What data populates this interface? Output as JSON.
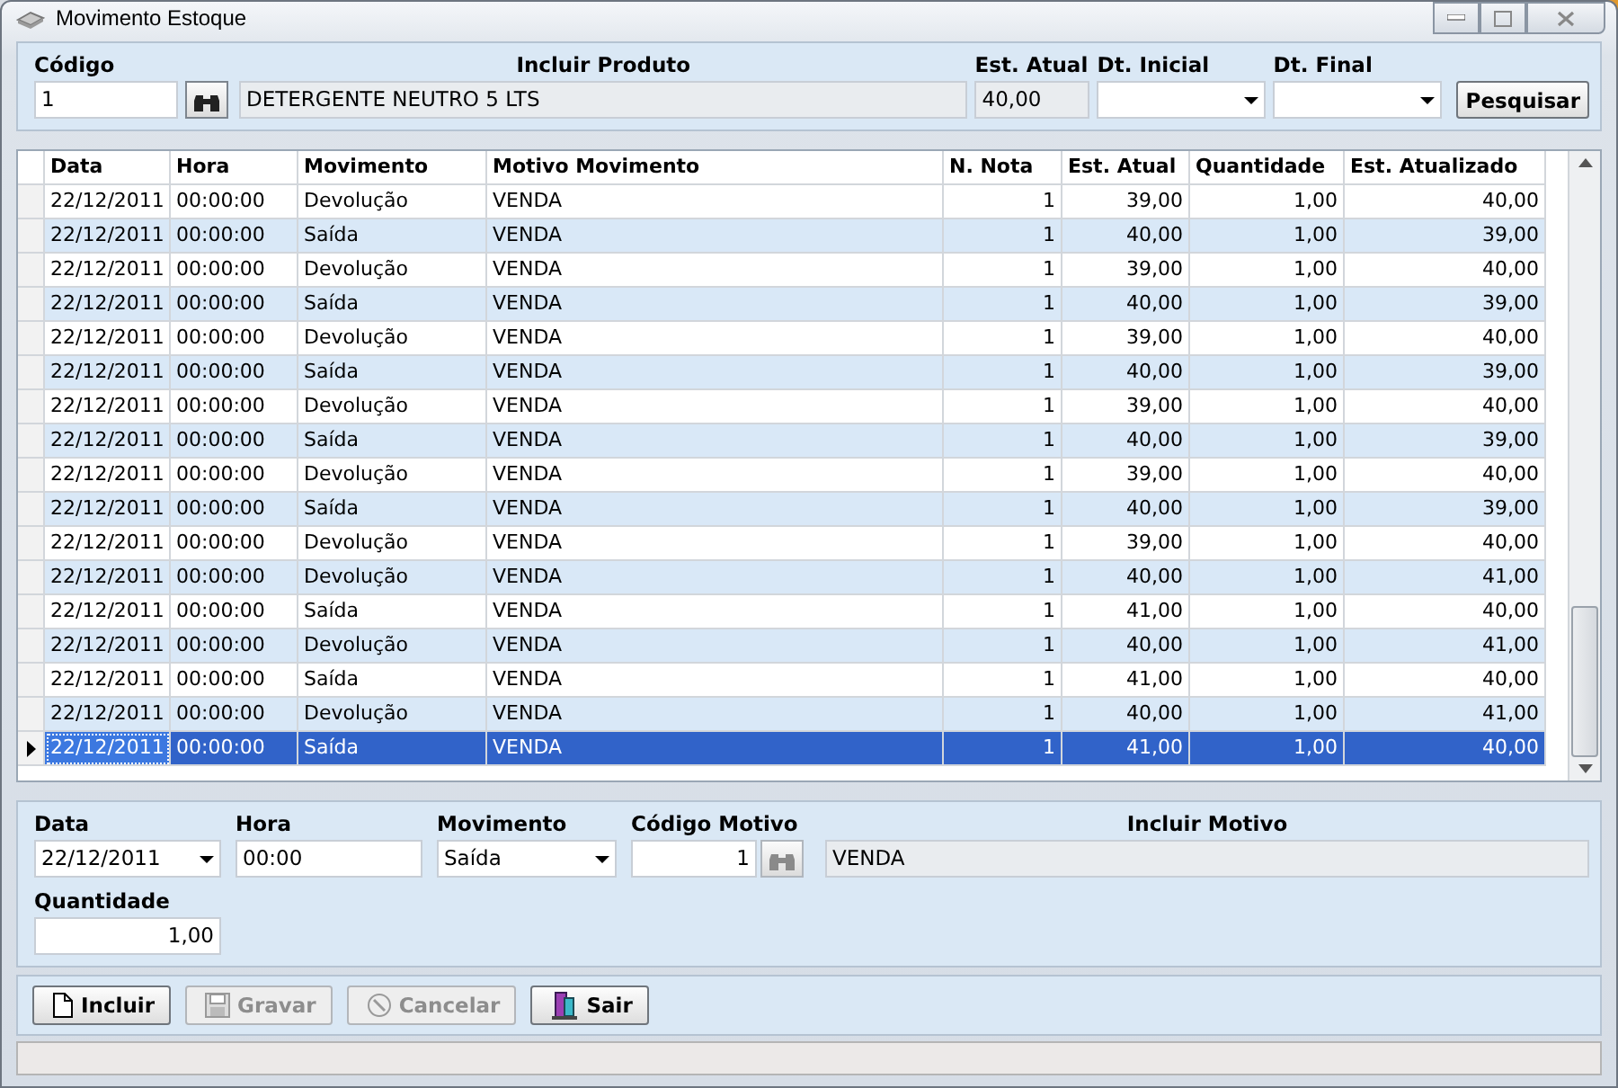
{
  "window": {
    "title": "Movimento Estoque"
  },
  "filter": {
    "codigo_label": "Código",
    "codigo": "1",
    "produto_label": "Incluir Produto",
    "produto": "DETERGENTE NEUTRO 5 LTS",
    "est_atual_label": "Est. Atual",
    "est_atual": "40,00",
    "dt_inicial_label": "Dt. Inicial",
    "dt_final_label": "Dt. Final",
    "search_button": "Pesquisar"
  },
  "table": {
    "columns": [
      "Data",
      "Hora",
      "Movimento",
      "Motivo Movimento",
      "N. Nota",
      "Est. Atual",
      "Quantidade",
      "Est. Atualizado"
    ],
    "rows": [
      {
        "cells": [
          "22/12/2011",
          "00:00:00",
          "Devolução",
          "VENDA",
          "1",
          "39,00",
          "1,00",
          "40,00"
        ],
        "selected": false
      },
      {
        "cells": [
          "22/12/2011",
          "00:00:00",
          "Saída",
          "VENDA",
          "1",
          "40,00",
          "1,00",
          "39,00"
        ],
        "selected": false
      },
      {
        "cells": [
          "22/12/2011",
          "00:00:00",
          "Devolução",
          "VENDA",
          "1",
          "39,00",
          "1,00",
          "40,00"
        ],
        "selected": false
      },
      {
        "cells": [
          "22/12/2011",
          "00:00:00",
          "Saída",
          "VENDA",
          "1",
          "40,00",
          "1,00",
          "39,00"
        ],
        "selected": false
      },
      {
        "cells": [
          "22/12/2011",
          "00:00:00",
          "Devolução",
          "VENDA",
          "1",
          "39,00",
          "1,00",
          "40,00"
        ],
        "selected": false
      },
      {
        "cells": [
          "22/12/2011",
          "00:00:00",
          "Saída",
          "VENDA",
          "1",
          "40,00",
          "1,00",
          "39,00"
        ],
        "selected": false
      },
      {
        "cells": [
          "22/12/2011",
          "00:00:00",
          "Devolução",
          "VENDA",
          "1",
          "39,00",
          "1,00",
          "40,00"
        ],
        "selected": false
      },
      {
        "cells": [
          "22/12/2011",
          "00:00:00",
          "Saída",
          "VENDA",
          "1",
          "40,00",
          "1,00",
          "39,00"
        ],
        "selected": false
      },
      {
        "cells": [
          "22/12/2011",
          "00:00:00",
          "Devolução",
          "VENDA",
          "1",
          "39,00",
          "1,00",
          "40,00"
        ],
        "selected": false
      },
      {
        "cells": [
          "22/12/2011",
          "00:00:00",
          "Saída",
          "VENDA",
          "1",
          "40,00",
          "1,00",
          "39,00"
        ],
        "selected": false
      },
      {
        "cells": [
          "22/12/2011",
          "00:00:00",
          "Devolução",
          "VENDA",
          "1",
          "39,00",
          "1,00",
          "40,00"
        ],
        "selected": false
      },
      {
        "cells": [
          "22/12/2011",
          "00:00:00",
          "Devolução",
          "VENDA",
          "1",
          "40,00",
          "1,00",
          "41,00"
        ],
        "selected": false
      },
      {
        "cells": [
          "22/12/2011",
          "00:00:00",
          "Saída",
          "VENDA",
          "1",
          "41,00",
          "1,00",
          "40,00"
        ],
        "selected": false
      },
      {
        "cells": [
          "22/12/2011",
          "00:00:00",
          "Devolução",
          "VENDA",
          "1",
          "40,00",
          "1,00",
          "41,00"
        ],
        "selected": false
      },
      {
        "cells": [
          "22/12/2011",
          "00:00:00",
          "Saída",
          "VENDA",
          "1",
          "41,00",
          "1,00",
          "40,00"
        ],
        "selected": false
      },
      {
        "cells": [
          "22/12/2011",
          "00:00:00",
          "Devolução",
          "VENDA",
          "1",
          "40,00",
          "1,00",
          "41,00"
        ],
        "selected": false
      },
      {
        "cells": [
          "22/12/2011",
          "00:00:00",
          "Saída",
          "VENDA",
          "1",
          "41,00",
          "1,00",
          "40,00"
        ],
        "selected": true
      }
    ]
  },
  "form": {
    "data_label": "Data",
    "data": "22/12/2011",
    "hora_label": "Hora",
    "hora": "00:00",
    "movimento_label": "Movimento",
    "movimento": "Saída",
    "codigo_motivo_label": "Código Motivo",
    "codigo_motivo": "1",
    "motivo_label": "Incluir Motivo",
    "motivo": "VENDA",
    "quantidade_label": "Quantidade",
    "quantidade": "1,00"
  },
  "buttons": [
    {
      "label": "Incluir",
      "kind": "new",
      "disabled": false
    },
    {
      "label": "Gravar",
      "kind": "save",
      "disabled": true
    },
    {
      "label": "Cancelar",
      "kind": "cancel",
      "disabled": true
    },
    {
      "label": "Sair",
      "kind": "exit",
      "disabled": false
    }
  ]
}
